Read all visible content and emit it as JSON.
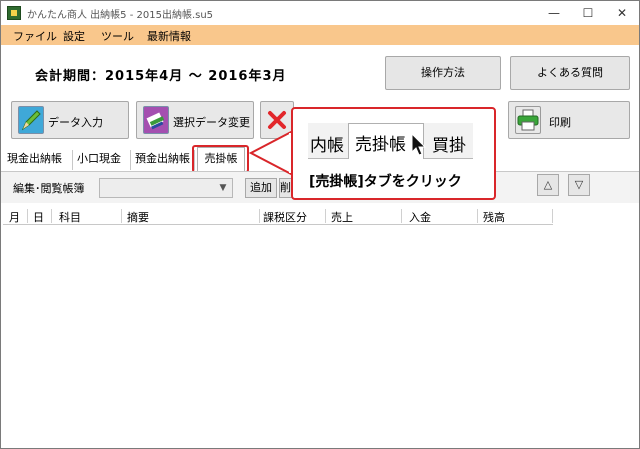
{
  "window": {
    "title": "かんたん商人 出納帳5 - 2015出納帳.su5",
    "minimize": "—",
    "maximize": "☐",
    "close": "✕"
  },
  "menu": {
    "items": [
      "ファイル",
      "設定",
      "ツール",
      "最新情報"
    ]
  },
  "period": {
    "text": "会計期間：2015年4月 〜 2016年3月"
  },
  "buttons": {
    "howto": "操作方法",
    "faq": "よくある質問"
  },
  "toolbar": {
    "data_entry": "データ入力",
    "edit_selected": "選択データ変更",
    "print": "印刷"
  },
  "tabs": {
    "items": [
      "現金出納帳",
      "小口現金",
      "預金出納帳"
    ],
    "active": "売掛帳"
  },
  "filter": {
    "label": "編集･閲覧帳簿",
    "add": "追加",
    "edit": "削除",
    "up": "△",
    "down": "▽"
  },
  "table": {
    "columns": [
      "月",
      "日",
      "科目",
      "摘要",
      "課税区分",
      "売上",
      "入金",
      "残高"
    ]
  },
  "callout": {
    "zoom_tabs": [
      "内帳",
      "売掛帳",
      "買掛"
    ],
    "instruction": "[売掛帳]タブをクリック"
  },
  "colors": {
    "menubar": "#f9c78c",
    "highlight": "#d9262a"
  }
}
